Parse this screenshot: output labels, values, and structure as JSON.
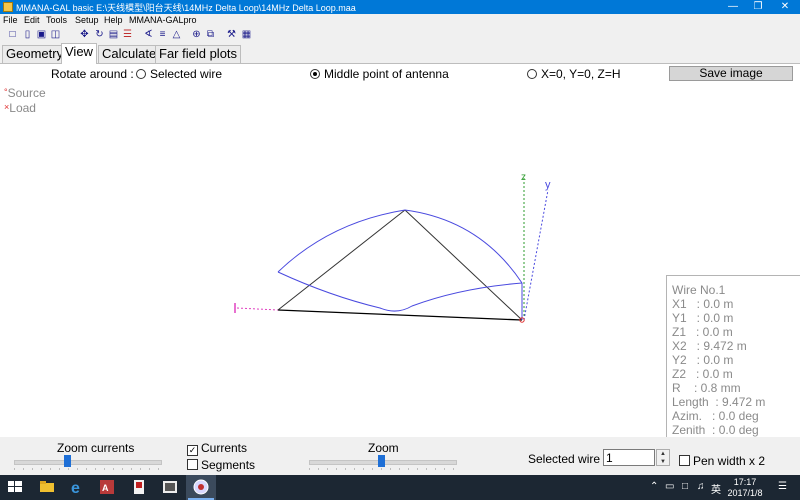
{
  "window": {
    "title": "MMANA-GAL basic E:\\天线模型\\阳台天线\\14MHz Delta Loop\\14MHz Delta Loop.maa",
    "controls": [
      "minimize-icon",
      "maximize-icon",
      "close-icon"
    ]
  },
  "menu": [
    "File",
    "Edit",
    "Tools",
    "Setup",
    "Help",
    "MMANA-GALpro"
  ],
  "toolbar_icons": [
    "new-file-icon",
    "open-folder-icon",
    "save-icon",
    "copy-icon",
    "move-icon",
    "rotate-icon",
    "wire-edit-icon",
    "table-icon",
    "source-icon",
    "load-icon",
    "triangle-icon",
    "target-icon",
    "duplicate-icon",
    "tools-icon",
    "calculator-icon"
  ],
  "tabs": [
    {
      "label": "Geometry",
      "active": false
    },
    {
      "label": "View",
      "active": true
    },
    {
      "label": "Calculate",
      "active": false
    },
    {
      "label": "Far field plots",
      "active": false
    }
  ],
  "rotate": {
    "label": "Rotate around :",
    "options": [
      {
        "label": "Selected wire",
        "selected": false
      },
      {
        "label": "Middle point of antenna",
        "selected": true
      },
      {
        "label": "X=0, Y=0, Z=H",
        "selected": false
      }
    ]
  },
  "save_image_label": "Save image",
  "legend": {
    "source": {
      "marker": "°",
      "label": "Source"
    },
    "load": {
      "marker": "×",
      "label": "Load"
    }
  },
  "axis_labels": {
    "z": "z",
    "y": "y"
  },
  "wire_info": {
    "title": "Wire No.1",
    "x1": "X1   : 0.0 m",
    "y1": "Y1   : 0.0 m",
    "z1": "Z1   : 0.0 m",
    "x2": "X2   : 9.472 m",
    "y2": "Y2   : 0.0 m",
    "z2": "Z2   : 0.0 m",
    "r": "R    : 0.8 mm",
    "length": "Length  : 9.472 m",
    "azim": "Azim.   : 0.0 deg",
    "zenith": "Zenith  : 0.0 deg"
  },
  "bottom": {
    "zoom_currents_label": "Zoom currents",
    "zoom_currents_level": 0.36,
    "currents": {
      "label": "Currents",
      "checked": true
    },
    "segments": {
      "label": "Segments",
      "checked": false
    },
    "zoom_label": "Zoom",
    "zoom_level": 0.49,
    "selected_wire_label": "Selected wire",
    "selected_wire_value": "1",
    "pen_width": {
      "label": "Pen width x 2",
      "checked": false
    }
  },
  "taskbar": {
    "apps": [
      "start-icon",
      "file-explorer-icon",
      "edge-icon",
      "access-icon",
      "app-icon",
      "photo-icon",
      "mmana-icon"
    ],
    "tray": {
      "ime": "英",
      "time": "17:17",
      "date": "2017/1/8"
    }
  },
  "colors": {
    "titlebar": "#0078d7",
    "current": "#4a4adf",
    "wire": "#000000",
    "z_axis": "#2e9b2e",
    "y_axis": "#4a4adf",
    "x_axis": "#e040c0",
    "source": "#e03030"
  }
}
